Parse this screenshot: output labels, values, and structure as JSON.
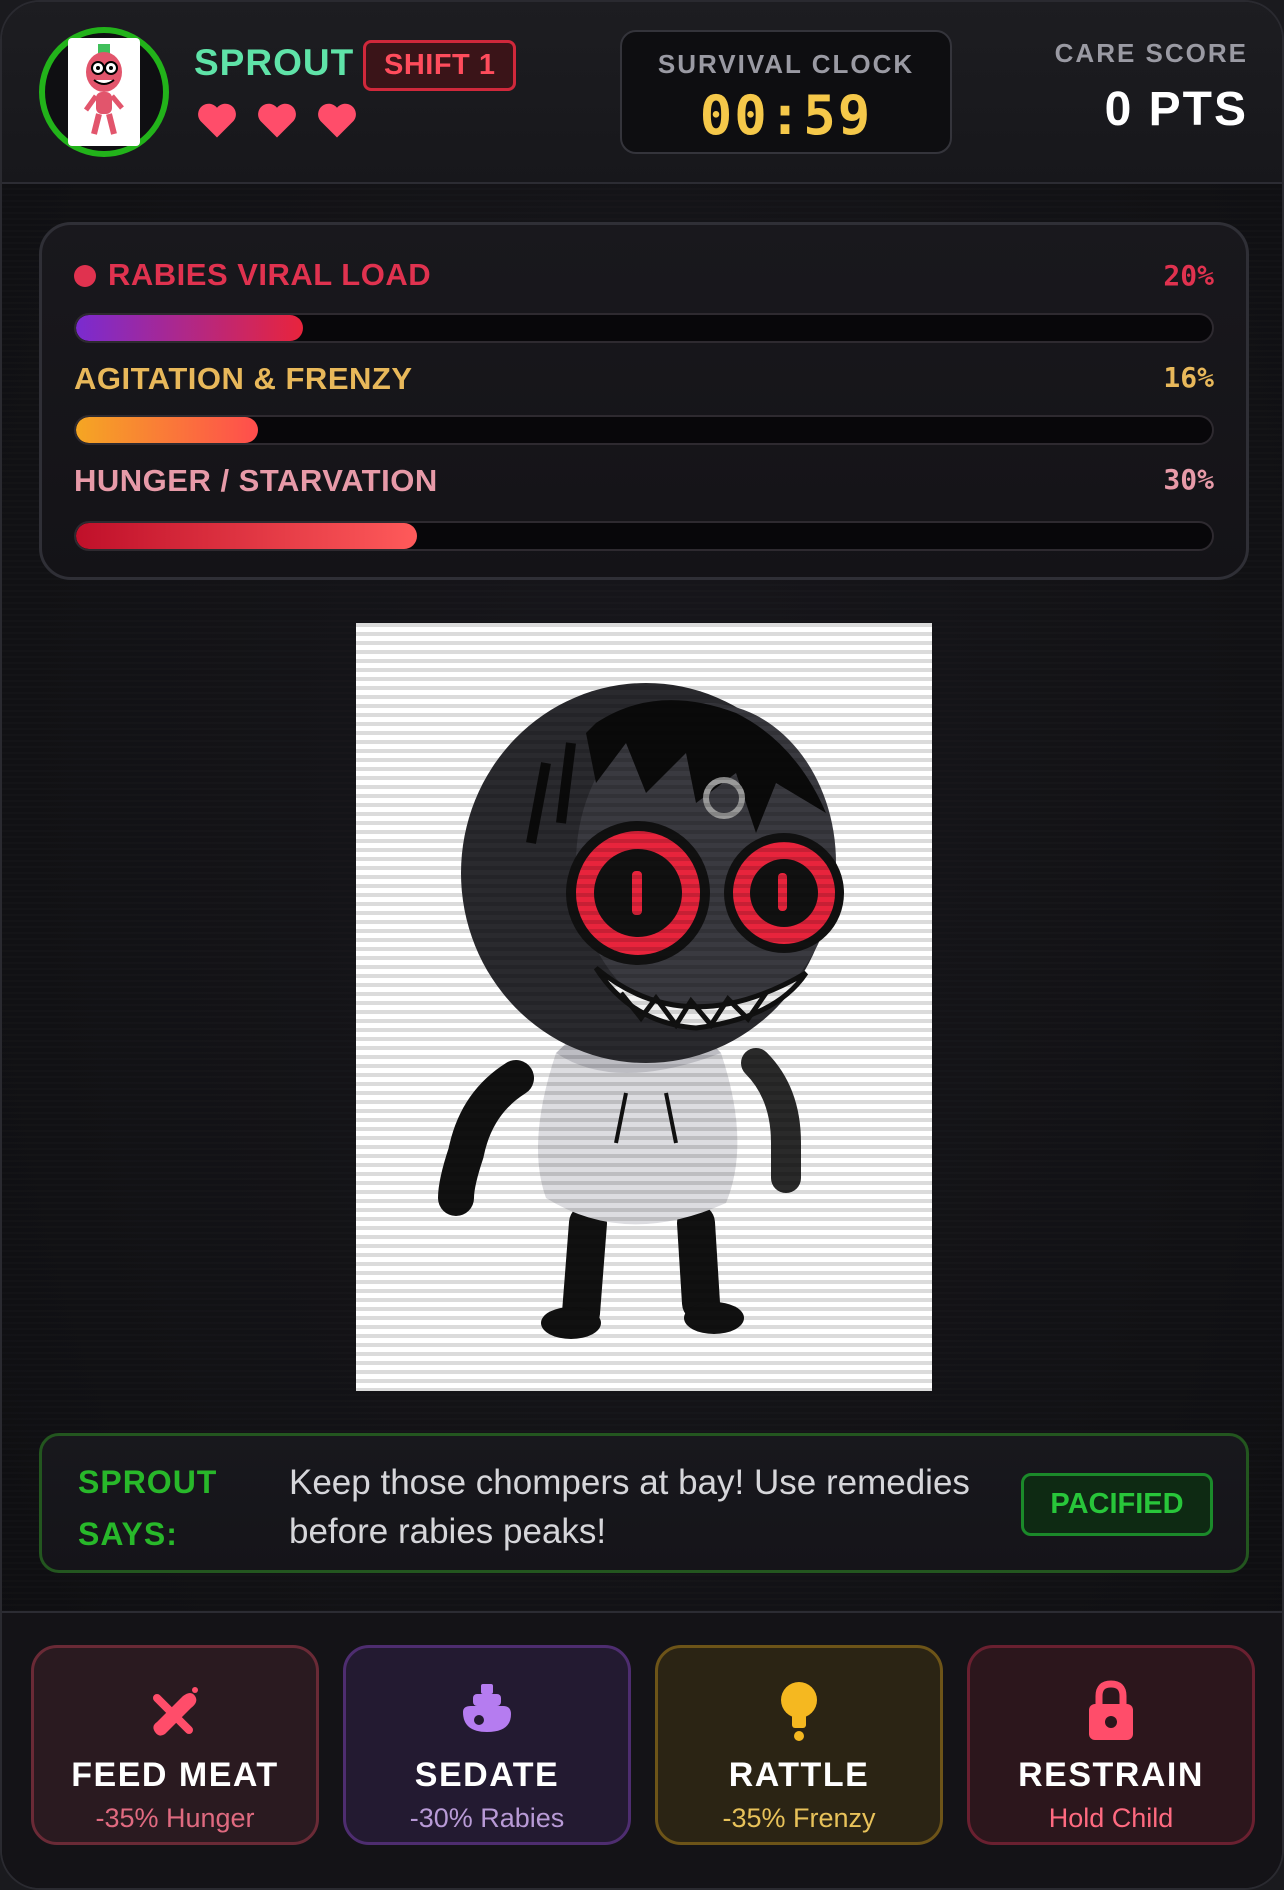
{
  "header": {
    "character_name": "SPROUT",
    "shift_label": "SHIFT 1",
    "lives": 3,
    "clock_label": "SURVIVAL CLOCK",
    "clock_value": "00:59",
    "score_label": "CARE SCORE",
    "score_value": "0 PTS"
  },
  "stats": [
    {
      "label": "RABIES VIRAL LOAD",
      "percent_text": "20%",
      "value": 0.2,
      "color": "#e0324f",
      "bar_from": "#7a2bd0",
      "bar_to": "#e8243c"
    },
    {
      "label": "AGITATION & FRENZY",
      "percent_text": "16%",
      "value": 0.16,
      "color": "#e8b85a",
      "bar_from": "#f5a623",
      "bar_to": "#ff4d4d"
    },
    {
      "label": "HUNGER / STARVATION",
      "percent_text": "30%",
      "value": 0.3,
      "color": "#e79aa8",
      "bar_from": "#c0102a",
      "bar_to": "#ff5a5a"
    }
  ],
  "dialog": {
    "speaker": "SPROUT SAYS:",
    "message": "Keep those chompers at bay! Use remedies before rabies peaks!",
    "status": "PACIFIED"
  },
  "actions": [
    {
      "title": "FEED MEAT",
      "subtitle": "-35% Hunger",
      "icon": "meat-icon",
      "accent": "#ff4d6a"
    },
    {
      "title": "SEDATE",
      "subtitle": "-30% Rabies",
      "icon": "sedative-icon",
      "accent": "#b57cf0"
    },
    {
      "title": "RATTLE",
      "subtitle": "-35% Frenzy",
      "icon": "rattle-icon",
      "accent": "#f5b820"
    },
    {
      "title": "RESTRAIN",
      "subtitle": "Hold Child",
      "icon": "lock-icon",
      "accent": "#ff4d6a"
    }
  ]
}
